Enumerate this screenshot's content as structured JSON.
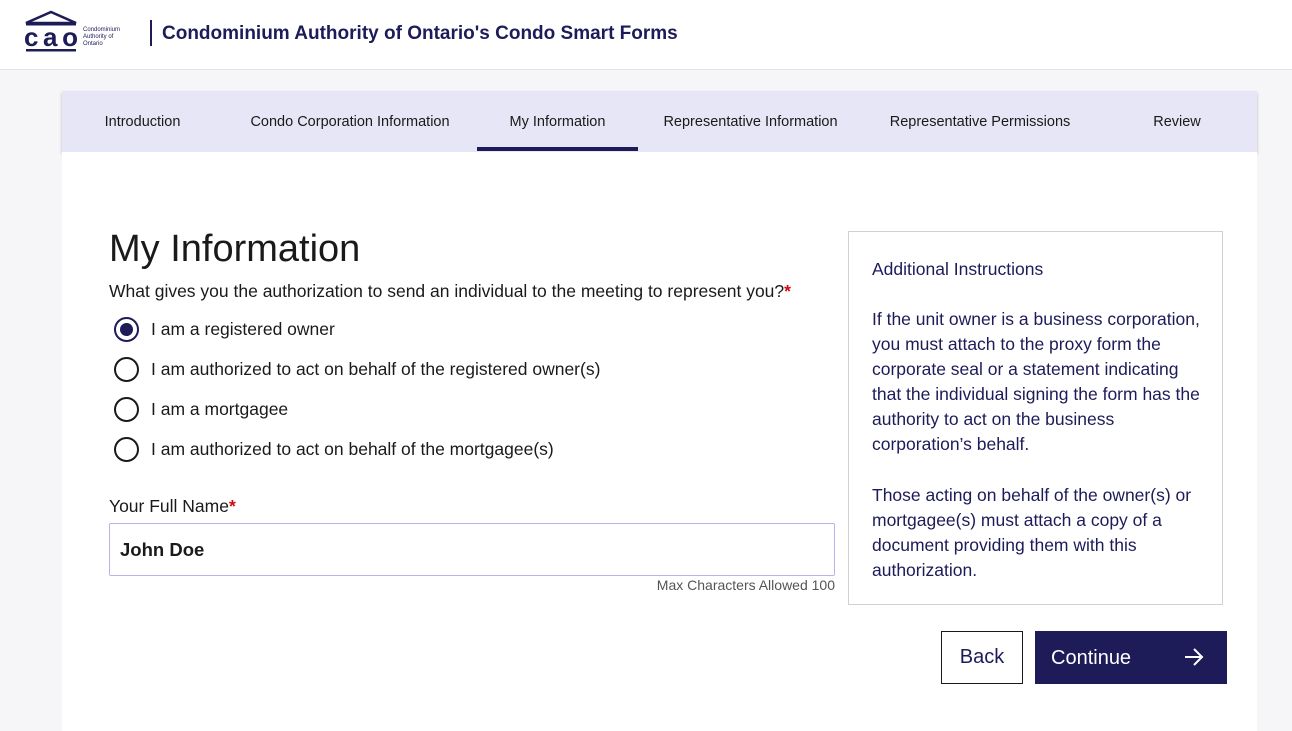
{
  "header": {
    "logo_text": "cao",
    "logo_subtext": [
      "Condominium",
      "Authority of",
      "Ontario"
    ],
    "title": "Condominium Authority of Ontario's Condo Smart Forms"
  },
  "tabs": [
    {
      "label": "Introduction",
      "active": false
    },
    {
      "label": "Condo Corporation Information",
      "active": false
    },
    {
      "label": "My Information",
      "active": true
    },
    {
      "label": "Representative Information",
      "active": false
    },
    {
      "label": "Representative Permissions",
      "active": false
    },
    {
      "label": "Review",
      "active": false
    }
  ],
  "form": {
    "title": "My Information",
    "question": "What gives you the authorization to send an individual to the meeting to represent you?",
    "required_mark": "*",
    "options": [
      {
        "label": "I am a registered owner",
        "selected": true
      },
      {
        "label": "I am authorized to act on behalf of the registered owner(s)",
        "selected": false
      },
      {
        "label": "I am a mortgagee",
        "selected": false
      },
      {
        "label": "I am authorized to act on behalf of the mortgagee(s)",
        "selected": false
      }
    ],
    "name_label": "Your Full Name",
    "name_value": "John Doe",
    "max_chars_hint": "Max Characters Allowed 100"
  },
  "instructions": {
    "title": "Additional Instructions",
    "paragraph_1": "If the unit owner is a business corporation, you must attach to the proxy form the corporate seal or a statement indicating that the individual signing the form has the authority to act on the business corporation’s behalf.",
    "paragraph_2": "Those acting on behalf of the owner(s) or mortgagee(s) must attach a copy of a document providing them with this authorization."
  },
  "buttons": {
    "back_label": "Back",
    "continue_label": "Continue",
    "continue_icon": "arrow-right-icon"
  },
  "colors": {
    "brand_navy": "#1d1b58",
    "tab_bar_bg": "#e6e6f6",
    "required_red": "#d3080c",
    "input_border": "#b9b4f0"
  }
}
